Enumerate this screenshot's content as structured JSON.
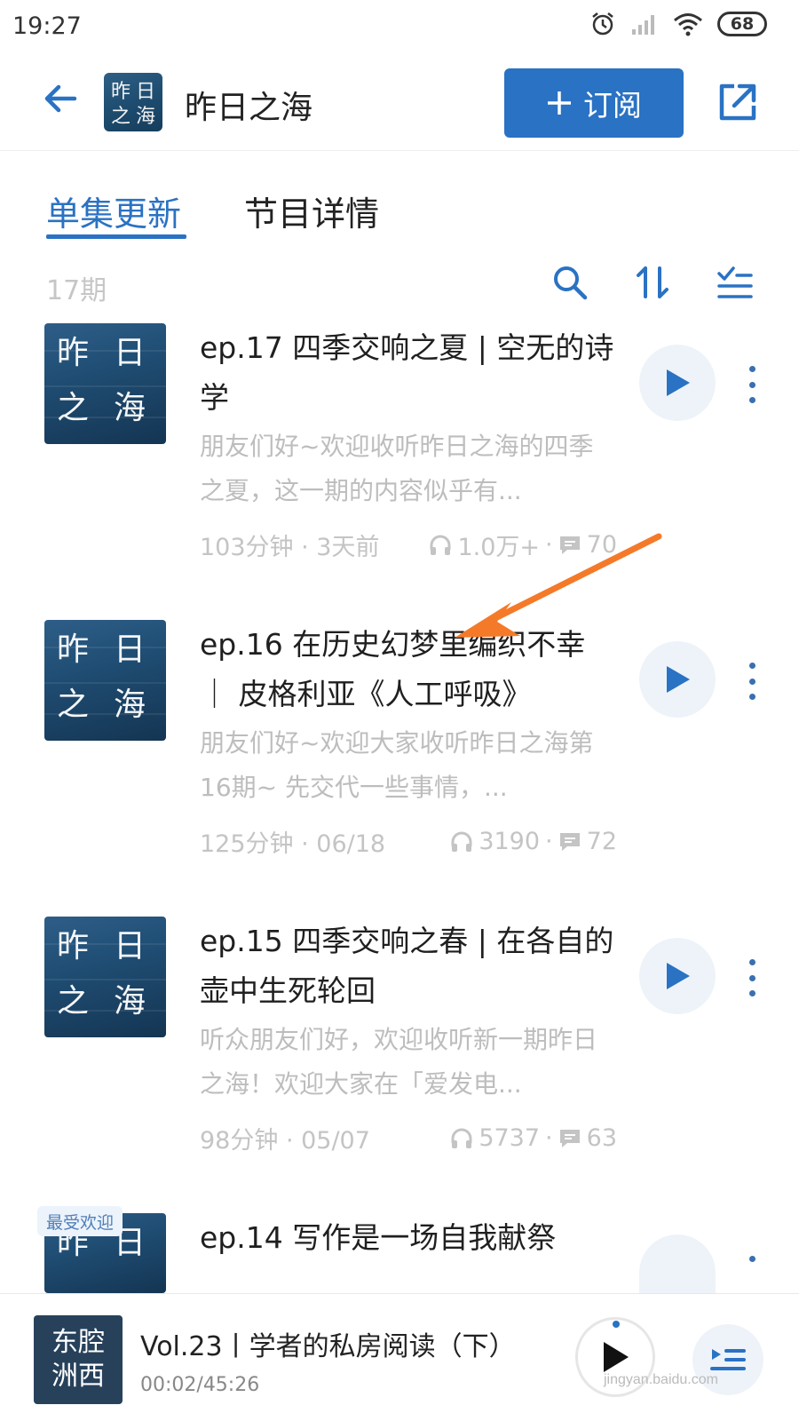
{
  "status_bar": {
    "time": "19:27",
    "battery": "68"
  },
  "header": {
    "show_title": "昨日之海",
    "subscribe_label": "订阅",
    "cover_text": "昨日之海"
  },
  "tabs": [
    {
      "label": "单集更新",
      "active": true
    },
    {
      "label": "节目详情",
      "active": false
    }
  ],
  "toolbar": {
    "count": "17期"
  },
  "episodes": [
    {
      "title": "ep.17 四季交响之夏 | 空无的诗学",
      "description": "朋友们好~欢迎收听昨日之海的四季之夏，这一期的内容似乎有...",
      "duration_date": "103分钟 · 3天前",
      "plays": "1.0万+",
      "comments": "70"
    },
    {
      "title": "ep.16 在历史幻梦里编织不幸 ｜ 皮格利亚《人工呼吸》",
      "description": "朋友们好~欢迎大家收听昨日之海第16期~ 先交代一些事情，...",
      "duration_date": "125分钟 · 06/18",
      "plays": "3190",
      "comments": "72"
    },
    {
      "title": "ep.15 四季交响之春 | 在各自的壶中生死轮回",
      "description": "听众朋友们好，欢迎收听新一期昨日之海！欢迎大家在「爱发电...",
      "duration_date": "98分钟 · 05/07",
      "plays": "5737",
      "comments": "63"
    },
    {
      "title": "ep.14 写作是一场自我献祭",
      "badge": "最受欢迎"
    }
  ],
  "player": {
    "title": "Vol.23丨学者的私房阅读（下）",
    "time": "00:02/45:26",
    "cover_line1": "东腔",
    "cover_line2": "洲西"
  },
  "watermark": "jingyan.baidu.com",
  "colors": {
    "accent": "#2a72c3",
    "annotation_arrow": "#f47a2a"
  }
}
